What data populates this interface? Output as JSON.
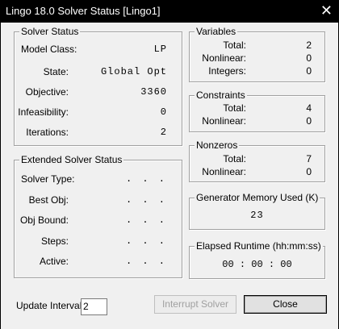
{
  "window": {
    "title": "Lingo 18.0 Solver Status [Lingo1]",
    "close_icon": "close-icon"
  },
  "solver_status": {
    "title": "Solver Status",
    "rows": [
      {
        "label": "Model Class:",
        "value": "LP"
      },
      {
        "label": "State:",
        "value": "Global Opt"
      },
      {
        "label": "Objective:",
        "value": "3360"
      },
      {
        "label": "Infeasibility:",
        "value": "0"
      },
      {
        "label": "Iterations:",
        "value": "2"
      }
    ]
  },
  "extended": {
    "title": "Extended Solver Status",
    "rows": [
      {
        "label": "Solver Type:",
        "value": ". . ."
      },
      {
        "label": "Best Obj:",
        "value": ". . ."
      },
      {
        "label": "Obj Bound:",
        "value": ". . ."
      },
      {
        "label": "Steps:",
        "value": ". . ."
      },
      {
        "label": "Active:",
        "value": ". . ."
      }
    ]
  },
  "variables": {
    "title": "Variables",
    "rows": [
      {
        "label": "Total:",
        "value": "2"
      },
      {
        "label": "Nonlinear:",
        "value": "0"
      },
      {
        "label": "Integers:",
        "value": "0"
      }
    ]
  },
  "constraints": {
    "title": "Constraints",
    "rows": [
      {
        "label": "Total:",
        "value": "4"
      },
      {
        "label": "Nonlinear:",
        "value": "0"
      }
    ]
  },
  "nonzeros": {
    "title": "Nonzeros",
    "rows": [
      {
        "label": "Total:",
        "value": "7"
      },
      {
        "label": "Nonlinear:",
        "value": "0"
      }
    ]
  },
  "memory": {
    "title": "Generator Memory Used (K)",
    "value": "23"
  },
  "runtime": {
    "title": "Elapsed Runtime (hh:mm:ss)",
    "value": "00 : 00 : 00"
  },
  "footer": {
    "update_label": "Update Interval:",
    "update_value": "2",
    "interrupt_label": "Interrupt Solver",
    "close_label": "Close"
  }
}
